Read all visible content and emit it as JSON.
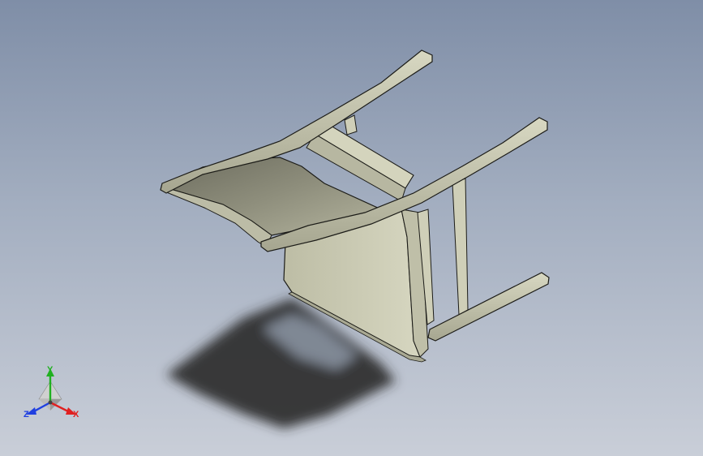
{
  "viewport": {
    "background_top": "#7f8ea7",
    "background_bottom": "#c9ced8"
  },
  "model": {
    "part_color": "#c9c9b0",
    "part_shade": "#9e9e88",
    "edge_color": "#1c1c18",
    "shadow_color": "#2b2b2b"
  },
  "triad": {
    "icon": "coordinate-triad-icon",
    "x_label": "X",
    "y_label": "Y",
    "z_label": "Z",
    "x_color": "#e02020",
    "y_color": "#20b020",
    "z_color": "#2040e0"
  }
}
